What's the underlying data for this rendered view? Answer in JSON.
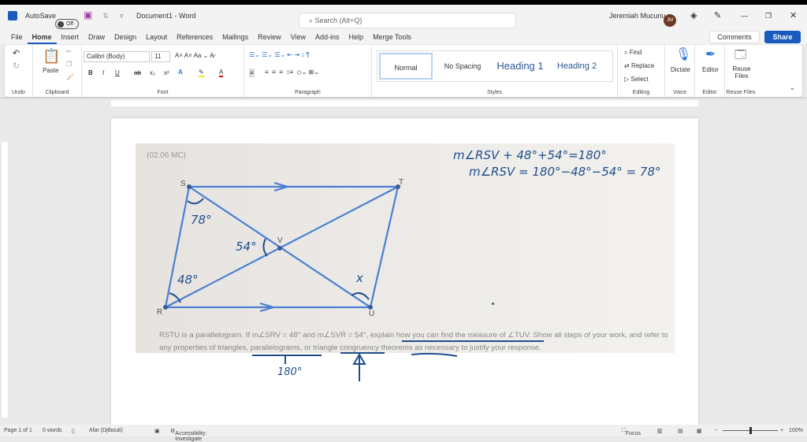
{
  "titlebar": {
    "autosave": "AutoSave",
    "toggle": "Off",
    "doc_title": "Document1 - Word",
    "search_placeholder": "Search (Alt+Q)",
    "user": "Jeremiah Mucunu",
    "initials": "JM"
  },
  "menu": [
    "File",
    "Home",
    "Insert",
    "Draw",
    "Design",
    "Layout",
    "References",
    "Mailings",
    "Review",
    "View",
    "Add-ins",
    "Help",
    "Merge Tools"
  ],
  "actions": {
    "comments": "Comments",
    "share": "Share"
  },
  "ribbon": {
    "groups": {
      "undo": "Undo",
      "clipboard": "Clipboard",
      "font": "Font",
      "paragraph": "Paragraph",
      "styles": "Styles",
      "editing": "Editing",
      "voice": "Voice",
      "editor": "Editor",
      "reuse": "Reuse Files"
    },
    "paste": "Paste",
    "font_name": "Calibri (Body)",
    "font_size": "11",
    "styles": [
      "Normal",
      "No Spacing",
      "Heading 1",
      "Heading 2"
    ],
    "find": "Find",
    "replace": "Replace",
    "select": "Select",
    "dictate": "Dictate",
    "editor_btn": "Editor",
    "reuse_btn": "Reuse Files"
  },
  "document": {
    "tag": "(02.06 MC)",
    "vertices": {
      "s": "S",
      "t": "T",
      "r": "R",
      "u": "U",
      "v": "V"
    },
    "question": "RSTU is a parallelogram. If m∠SRV = 48° and m∠SVR = 54°, explain how you can find the measure of ∠TUV. Show all steps of your work, and refer to any properties of triangles, parallelograms, or triangle congruency theorems as necessary to justify your response.",
    "handwriting": {
      "line1": "m∠RSV + 48°+54°=180°",
      "line2": "m∠RSV = 180°−48°−54° = 78°",
      "a78": "78°",
      "a54": "54°",
      "a48": "48°",
      "x": "x",
      "n180": "180°"
    }
  },
  "status": {
    "page": "Page 1 of 1",
    "words": "0 words",
    "language": "Afar (Djibouti)",
    "accessibility": "Accessibility: Investigate",
    "focus": "Focus",
    "zoom": "100%"
  },
  "zoom_level": 100
}
